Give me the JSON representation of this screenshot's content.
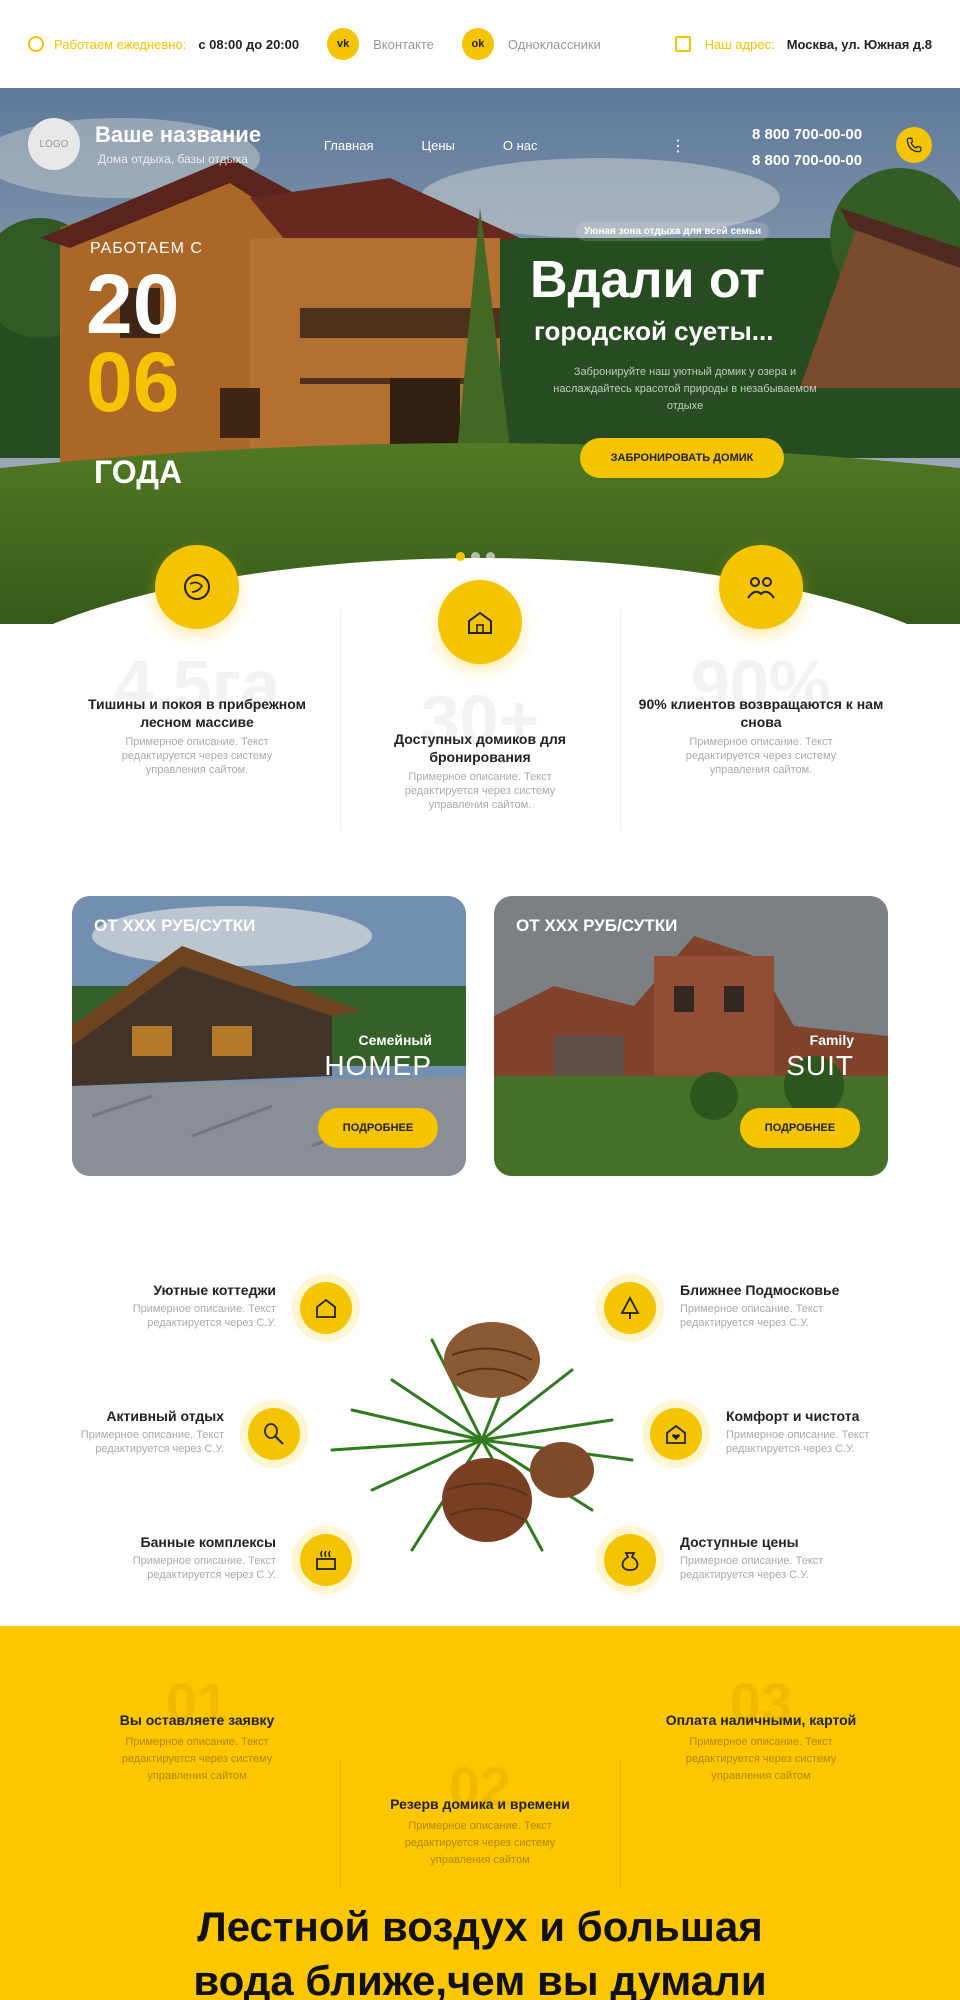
{
  "topbar": {
    "hours_label": "Работаем ежедневно:",
    "hours_value": "с 08:00 до 20:00",
    "vk_icon": "vk-icon",
    "vk_label": "Вконтакте",
    "ok_icon": "odnoklassniki-icon",
    "ok_label": "Одноклассники",
    "address_label": "Наш адрес:",
    "address_value": "Москва, ул. Южная д.8"
  },
  "header": {
    "logo": "LOGO",
    "brand": "Ваше название",
    "brand_sub": "Дома отдыха, базы отдыха",
    "nav": [
      "Главная",
      "Цены",
      "О нас"
    ],
    "menu": "⋮",
    "phone1": "8 800 700-00-00",
    "phone2": "8 800 700-00-00"
  },
  "hero": {
    "since": "РАБОТАЕМ С",
    "year1": "20",
    "year2": "06",
    "years": "ГОДА",
    "tag": "Уюная зона отдыха для всей семьи",
    "title": "Вдали от",
    "subtitle": "городской суеты...",
    "desc": "Забронируйте наш уютный домик у озера и наслаждайтесь красотой природы в незабываемом отдыхе",
    "cta": "ЗАБРОНИРОВАТЬ ДОМИК",
    "slides": 3,
    "active_slide": 1
  },
  "stats": [
    {
      "big": "4.5га",
      "title": "Тишины и покоя в прибрежном лесном массиве",
      "desc": "Примерное описание. Текст редактируется через систему управления сайтом."
    },
    {
      "big": "30+",
      "title": "Доступных домиков для бронирования",
      "desc": "Примерное описание. Текст редактируется через систему управления сайтом."
    },
    {
      "big": "90%",
      "title": "90% клиентов возвращаются к нам снова",
      "desc": "Примерное описание. Текст редактируется через систему управления сайтом."
    }
  ],
  "cards": [
    {
      "price": "ОТ XXX РУБ/СУТКИ",
      "small": "Семейный",
      "large": "НОМЕР",
      "button": "ПОДРОБНЕЕ"
    },
    {
      "price": "ОТ XXX РУБ/СУТКИ",
      "small": "Family",
      "large": "SUIT",
      "button": "ПОДРОБНЕЕ"
    }
  ],
  "features_left": [
    {
      "title": "Уютные коттеджи",
      "desc": "Примерное описание. Текст редактируется через С.У.",
      "icon": "cottage-icon"
    },
    {
      "title": "Активный отдых",
      "desc": "Примерное описание. Текст редактируется через С.У.",
      "icon": "tennis-icon"
    },
    {
      "title": "Банные комплексы",
      "desc": "Примерное описание. Текст редактируется через С.У.",
      "icon": "sauna-icon"
    }
  ],
  "features_right": [
    {
      "title": "Ближнее Подмосковье",
      "desc": "Примерное описание. Текст редактируется через С.У.",
      "icon": "tree-icon"
    },
    {
      "title": "Комфорт и чистота",
      "desc": "Примерное описание. Текст редактируется через С.У.",
      "icon": "house-heart-icon"
    },
    {
      "title": "Доступные цены",
      "desc": "Примерное описание. Текст редактируется через С.У.",
      "icon": "money-bag-icon"
    }
  ],
  "steps": [
    {
      "num": "01",
      "title": "Вы оставляете заявку",
      "desc": "Примерное описание. Текст редактируется через систему управления сайтом"
    },
    {
      "num": "02",
      "title": "Резерв домика и времени",
      "desc": "Примерное описание. Текст редактируется через систему управления сайтом"
    },
    {
      "num": "03",
      "title": "Оплата наличными, картой",
      "desc": "Примерное описание. Текст редактируется через систему управления сайтом"
    }
  ],
  "bottom": {
    "line1": "Лестной воздух и большая",
    "line2": "вода ближе,чем вы думали"
  },
  "colors": {
    "accent": "#f5c400",
    "yellow_bg": "#fcc600"
  }
}
